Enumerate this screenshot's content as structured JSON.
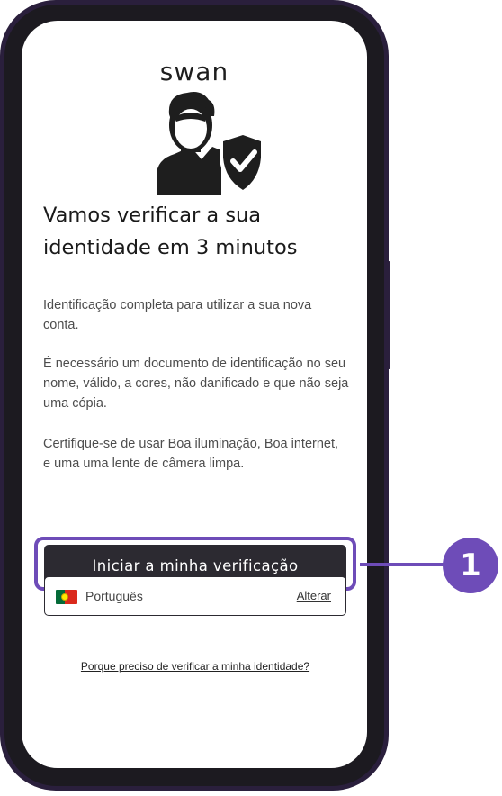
{
  "app": {
    "logo_text": "swan"
  },
  "verification": {
    "title": "Vamos verificar a sua identidade em 3 minutos",
    "paragraphs": [
      "Identificação completa para utilizar a sua nova conta.",
      "É necessário um documento de identificação no seu nome, válido, a cores, não danificado e que não seja uma cópia.",
      "Certifique-se de usar Boa iluminação, Boa internet, e uma uma lente de câmera limpa."
    ],
    "start_button_label": "Iniciar a minha verificação",
    "language": {
      "name": "Português",
      "change_label": "Alterar",
      "flag": "portugal-flag"
    },
    "why_link": "Porque preciso de verificar a minha identidade?"
  },
  "annotation": {
    "step_number": "1",
    "color": "#6e4cb8"
  },
  "colors": {
    "primary_button": "#2c2a31",
    "phone_frame": "#2a1f3c"
  },
  "icons": {
    "avatar": "user-shield-check-icon"
  }
}
